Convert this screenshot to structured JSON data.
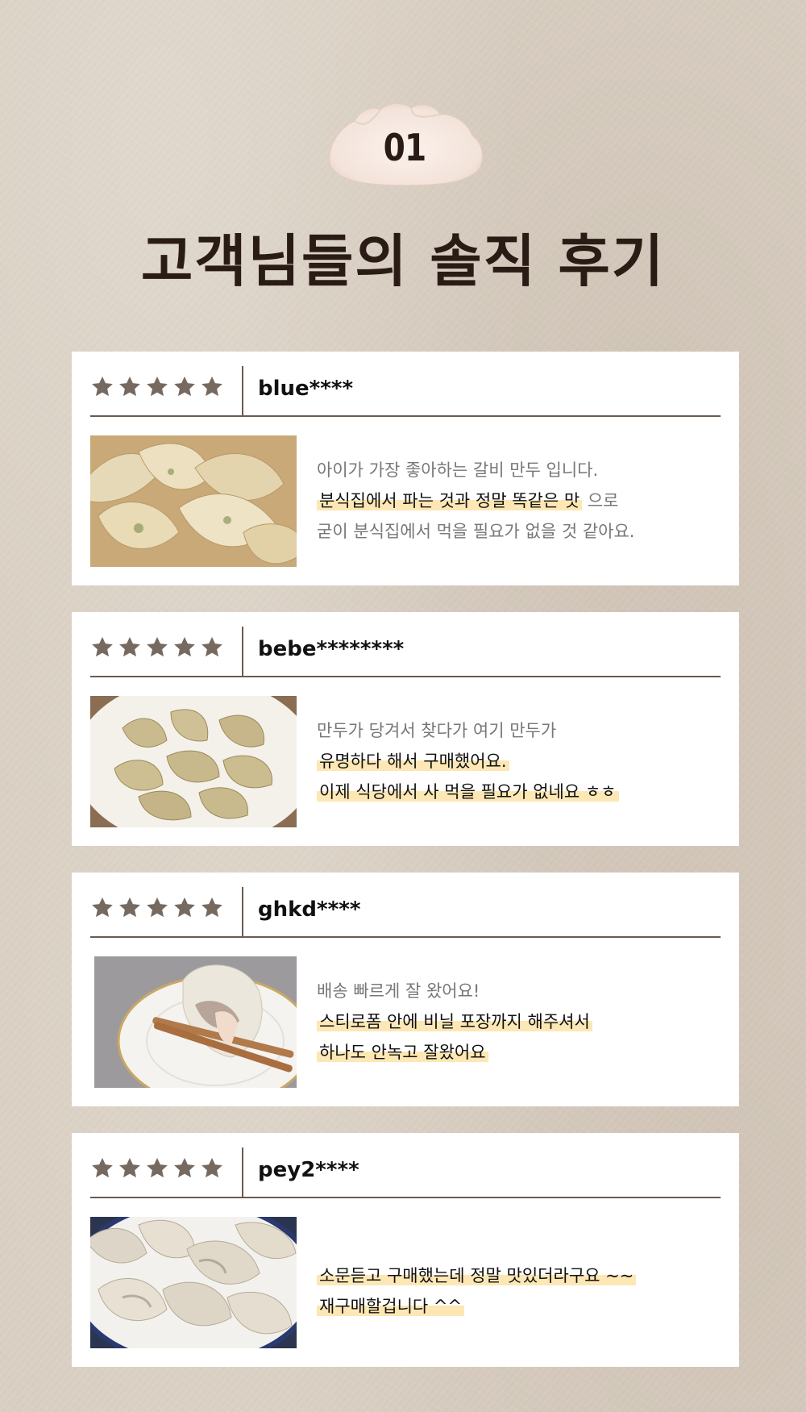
{
  "badge": {
    "number": "01"
  },
  "page_title": "고객님들의 솔직 후기",
  "colors": {
    "star": "#766960",
    "highlight": "#fde7b4",
    "divider": "#6b5a50",
    "title": "#2a1c14"
  },
  "reviews": [
    {
      "rating": 5,
      "reviewer": "blue****",
      "photo": "steamed-dumplings-plate",
      "lines": [
        {
          "parts": [
            {
              "text": "아이가 가장 좋아하는 갈비 만두 입니다.",
              "highlight": false
            }
          ]
        },
        {
          "parts": [
            {
              "text": "분식집에서 파는 것과 정말 똑같은 맛",
              "highlight": true
            },
            {
              "text": " 으로",
              "highlight": false
            }
          ]
        },
        {
          "parts": [
            {
              "text": "굳이 분식집에서 먹을 필요가 없을 것 같아요.",
              "highlight": false
            }
          ]
        }
      ]
    },
    {
      "rating": 5,
      "reviewer": "bebe********",
      "photo": "dumplings-on-white-plate",
      "lines": [
        {
          "parts": [
            {
              "text": "만두가 당겨서 찾다가 여기 만두가",
              "highlight": false
            }
          ]
        },
        {
          "parts": [
            {
              "text": "유명하다 해서 구매했어요.",
              "highlight": true
            }
          ]
        },
        {
          "parts": [
            {
              "text": "이제 식당에서 사 먹을 필요가 없네요 ㅎㅎ",
              "highlight": true
            }
          ]
        }
      ]
    },
    {
      "rating": 5,
      "reviewer": "ghkd****",
      "photo": "dumpling-with-chopsticks",
      "lines": [
        {
          "parts": [
            {
              "text": "배송 빠르게 잘 왔어요!",
              "highlight": false
            }
          ]
        },
        {
          "parts": [
            {
              "text": "스티로폼 안에 비닐 포장까지 해주셔서",
              "highlight": true
            }
          ]
        },
        {
          "parts": [
            {
              "text": "하나도 안녹고 잘왔어요",
              "highlight": true
            }
          ]
        }
      ]
    },
    {
      "rating": 5,
      "reviewer": "pey2****",
      "photo": "dumplings-blue-rim-plate",
      "lines": [
        {
          "parts": [
            {
              "text": "소문듣고 구매했는데 정말 맛있더라구요 ~~",
              "highlight": true
            }
          ]
        },
        {
          "parts": [
            {
              "text": "재구매할겁니다 ^^",
              "highlight": true
            }
          ]
        }
      ]
    }
  ]
}
